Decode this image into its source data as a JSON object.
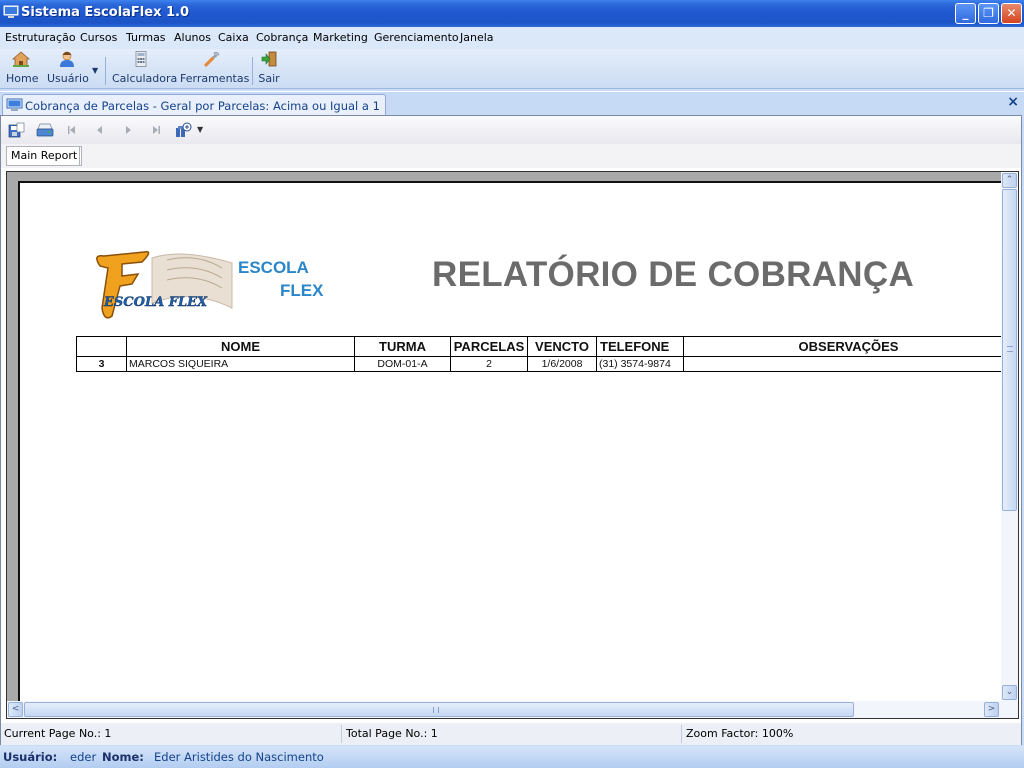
{
  "window": {
    "title": "Sistema EscolaFlex 1.0",
    "controls": {
      "minimize": "_",
      "restore": "❐",
      "close": "✕"
    }
  },
  "menu": {
    "items": [
      "Estruturação",
      "Cursos",
      "Turmas",
      "Alunos",
      "Caixa",
      "Cobrança",
      "Marketing",
      "Gerenciamento",
      "Janela"
    ]
  },
  "toolbar": {
    "home": "Home",
    "user": "Usuário",
    "calculator": "Calculadora",
    "tools": "Ferramentas",
    "exit": "Sair"
  },
  "document": {
    "tab_title": "Cobrança de Parcelas - Geral por Parcelas: Acima ou Igual a 1",
    "close": "×"
  },
  "viewer": {
    "tab": "Main Report",
    "status": {
      "current_page": "Current Page No.: 1",
      "total_page": "Total Page No.: 1",
      "zoom": "Zoom Factor: 100%"
    }
  },
  "report": {
    "logo_line1": "ESCOLA",
    "logo_line2": "FLEX",
    "logo_image_text": "ESCOLA FLEX",
    "title": "RELATÓRIO DE COBRANÇA",
    "columns": [
      "",
      "NOME",
      "TURMA",
      "PARCELAS",
      "VENCTO",
      "TELEFONE",
      "OBSERVAÇÕES"
    ],
    "rows": [
      {
        "num": "3",
        "nome": "MARCOS SIQUEIRA",
        "turma": "DOM-01-A",
        "parcelas": "2",
        "vencto": "1/6/2008",
        "telefone": "(31) 3574-9874",
        "observacoes": ""
      }
    ]
  },
  "statusbar": {
    "user_label": "Usuário:",
    "user_value": "eder",
    "name_label": "Nome:",
    "name_value": "Eder Aristides do Nascimento"
  }
}
